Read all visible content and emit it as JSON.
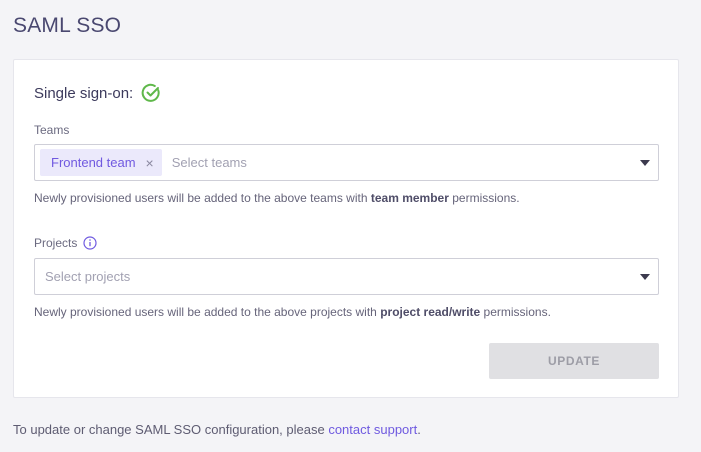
{
  "page": {
    "title": "SAML SSO"
  },
  "card": {
    "title": "Single sign-on:",
    "status": "enabled",
    "teams": {
      "label": "Teams",
      "selected_tags": [
        "Frontend team"
      ],
      "placeholder": "Select teams",
      "helper_prefix": "Newly provisioned users will be added to the above teams with ",
      "helper_bold": "team member",
      "helper_suffix": " permissions."
    },
    "projects": {
      "label": "Projects",
      "placeholder": "Select projects",
      "helper_prefix": "Newly provisioned users will be added to the above projects with ",
      "helper_bold": "project read/write",
      "helper_suffix": " permissions."
    },
    "update_button": "UPDATE"
  },
  "footer": {
    "text_prefix": "To update or change SAML SSO configuration, please ",
    "link_text": "contact support",
    "text_suffix": "."
  },
  "colors": {
    "accent": "#6f5ae0",
    "success": "#5fb84a",
    "button_disabled_bg": "#e0e0e3"
  },
  "icons": [
    "check-circle-icon",
    "info-icon",
    "close-icon",
    "caret-down-icon"
  ]
}
